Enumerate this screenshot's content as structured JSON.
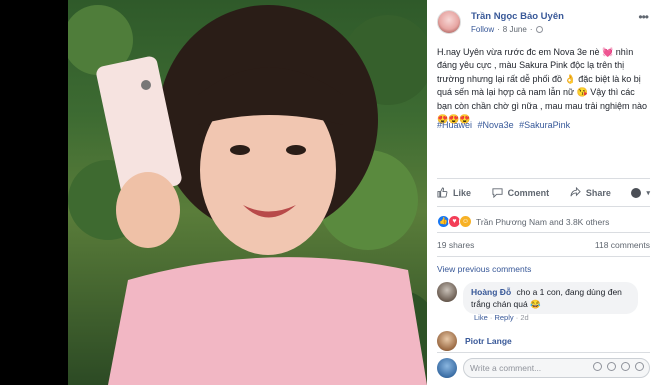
{
  "author": {
    "name": "Trần Ngọc Bảo Uyên",
    "follow_label": "Follow",
    "separator": "·",
    "date": "8 June",
    "visibility_icon": "globe-icon"
  },
  "post": {
    "text": "H.nay Uyên vừa rước đc em Nova 3e nè 💓 nhìn đáng yêu cực , màu Sakura Pink độc lạ trên thị trường nhưng lại rất dễ phối đồ 👌 đặc biệt là ko bị quá sến mà lại hợp cả nam lẫn nữ 😘 Vậy thì các bạn còn chần chờ gì nữa , mau mau trải nghiệm nào 😍😍😍",
    "hashtags": [
      "#Huawei",
      "#Nova3e",
      "#SakuraPink"
    ]
  },
  "actions": {
    "like": "Like",
    "comment": "Comment",
    "share": "Share"
  },
  "reactions": {
    "summary": "Trần Phương Nam and 3.8K others",
    "types": [
      "like",
      "love",
      "haha"
    ]
  },
  "counts": {
    "shares": "19 shares",
    "comments": "118 comments"
  },
  "view_previous": "View previous comments",
  "comments": [
    {
      "name": "Hoàng Đỗ",
      "text": "cho a 1 con, đang dùng đen trắng chán quá 😂",
      "like_label": "Like",
      "reply_label": "Reply",
      "time": "2d"
    },
    {
      "name": "Piotr Lange"
    }
  ],
  "composer": {
    "placeholder": "Write a comment..."
  },
  "colors": {
    "link": "#385898",
    "like": "#1877f2",
    "love": "#f33e58",
    "haha": "#f7b125"
  }
}
